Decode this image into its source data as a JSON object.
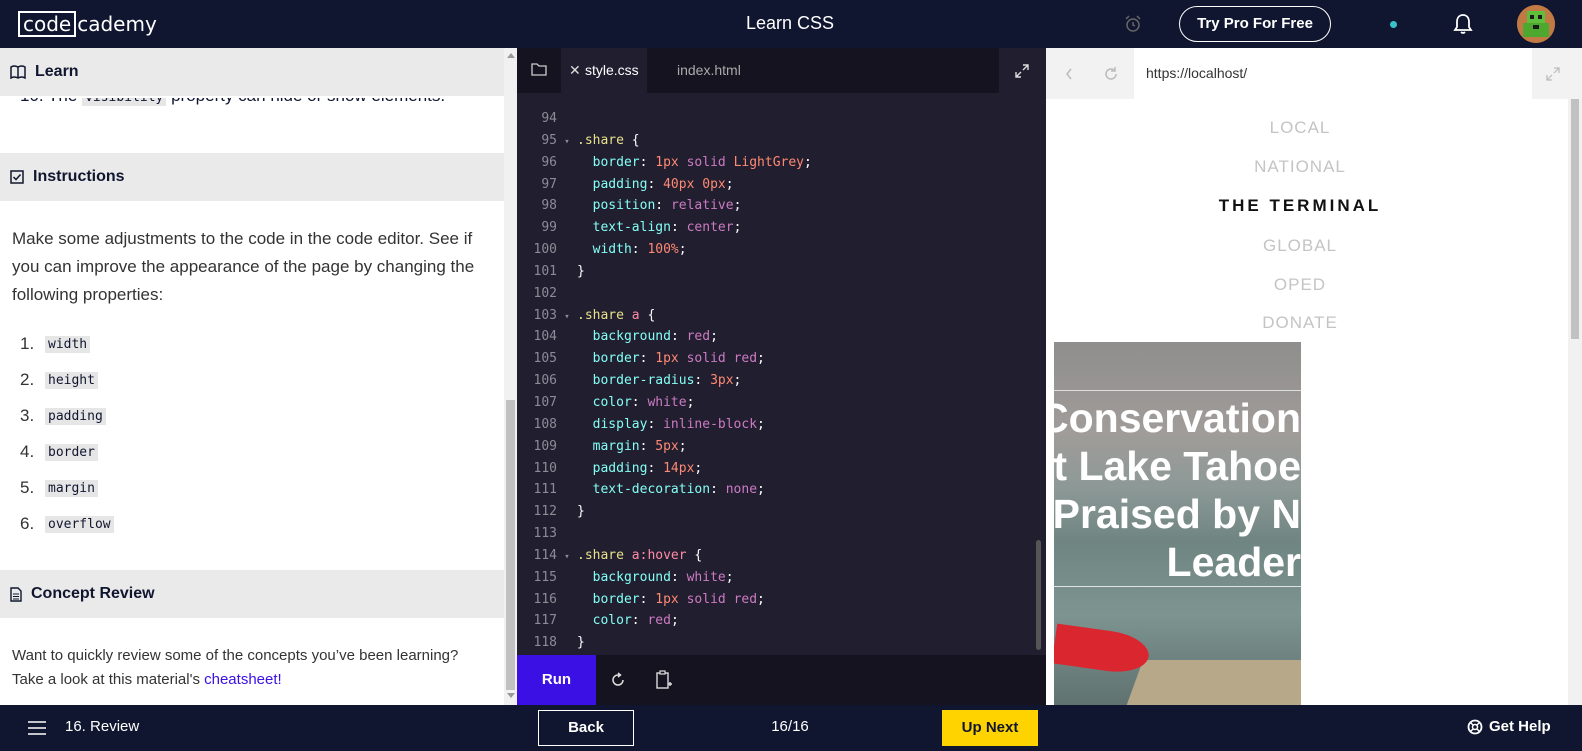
{
  "topbar": {
    "logo_box": "code",
    "logo_rest": "cademy",
    "title": "Learn CSS",
    "pro_button": "Try Pro For Free"
  },
  "left": {
    "learn_label": "Learn",
    "cut_item_number": "10. The",
    "cut_item_code": "visibility",
    "cut_item_rest": "property can hide or show elements.",
    "instructions_label": "Instructions",
    "instructions_text": "Make some adjustments to the code in the code editor. See if you can improve the appearance of the page by changing the following properties:",
    "properties": [
      {
        "n": "1.",
        "code": "width"
      },
      {
        "n": "2.",
        "code": "height"
      },
      {
        "n": "3.",
        "code": "padding"
      },
      {
        "n": "4.",
        "code": "border"
      },
      {
        "n": "5.",
        "code": "margin"
      },
      {
        "n": "6.",
        "code": "overflow"
      }
    ],
    "concept_label": "Concept Review",
    "concept_text": "Want to quickly review some of the concepts you’ve been learning? Take a look at this material's",
    "concept_link": "cheatsheet!"
  },
  "editor": {
    "tab_active": "style.css",
    "tab_inactive": "index.html",
    "run_label": "Run",
    "lines": [
      {
        "n": "94",
        "fold": "",
        "tokens": []
      },
      {
        "n": "95",
        "fold": "▾",
        "tokens": [
          [
            "c-sel",
            ".share "
          ],
          [
            "c-plain",
            "{"
          ]
        ]
      },
      {
        "n": "96",
        "fold": "",
        "tokens": [
          [
            "c-plain",
            "  "
          ],
          [
            "c-prop",
            "border"
          ],
          [
            "c-plain",
            ": "
          ],
          [
            "c-num",
            "1px"
          ],
          [
            "c-plain",
            " "
          ],
          [
            "c-str",
            "solid"
          ],
          [
            "c-plain",
            " "
          ],
          [
            "c-num",
            "LightGrey"
          ],
          [
            "c-plain",
            ";"
          ]
        ]
      },
      {
        "n": "97",
        "fold": "",
        "tokens": [
          [
            "c-plain",
            "  "
          ],
          [
            "c-prop",
            "padding"
          ],
          [
            "c-plain",
            ": "
          ],
          [
            "c-num",
            "40px 0px"
          ],
          [
            "c-plain",
            ";"
          ]
        ]
      },
      {
        "n": "98",
        "fold": "",
        "tokens": [
          [
            "c-plain",
            "  "
          ],
          [
            "c-prop",
            "position"
          ],
          [
            "c-plain",
            ": "
          ],
          [
            "c-str",
            "relative"
          ],
          [
            "c-plain",
            ";"
          ]
        ]
      },
      {
        "n": "99",
        "fold": "",
        "tokens": [
          [
            "c-plain",
            "  "
          ],
          [
            "c-prop",
            "text-align"
          ],
          [
            "c-plain",
            ": "
          ],
          [
            "c-str",
            "center"
          ],
          [
            "c-plain",
            ";"
          ]
        ]
      },
      {
        "n": "100",
        "fold": "",
        "tokens": [
          [
            "c-plain",
            "  "
          ],
          [
            "c-prop",
            "width"
          ],
          [
            "c-plain",
            ": "
          ],
          [
            "c-num",
            "100%"
          ],
          [
            "c-plain",
            ";"
          ]
        ]
      },
      {
        "n": "101",
        "fold": "",
        "tokens": [
          [
            "c-plain",
            "}"
          ]
        ]
      },
      {
        "n": "102",
        "fold": "",
        "tokens": []
      },
      {
        "n": "103",
        "fold": "▾",
        "tokens": [
          [
            "c-sel",
            ".share "
          ],
          [
            "c-hover",
            "a"
          ],
          [
            "c-plain",
            " {"
          ]
        ]
      },
      {
        "n": "104",
        "fold": "",
        "tokens": [
          [
            "c-plain",
            "  "
          ],
          [
            "c-prop",
            "background"
          ],
          [
            "c-plain",
            ": "
          ],
          [
            "c-str",
            "red"
          ],
          [
            "c-plain",
            ";"
          ]
        ]
      },
      {
        "n": "105",
        "fold": "",
        "tokens": [
          [
            "c-plain",
            "  "
          ],
          [
            "c-prop",
            "border"
          ],
          [
            "c-plain",
            ": "
          ],
          [
            "c-num",
            "1px"
          ],
          [
            "c-plain",
            " "
          ],
          [
            "c-str",
            "solid"
          ],
          [
            "c-plain",
            " "
          ],
          [
            "c-str",
            "red"
          ],
          [
            "c-plain",
            ";"
          ]
        ]
      },
      {
        "n": "106",
        "fold": "",
        "tokens": [
          [
            "c-plain",
            "  "
          ],
          [
            "c-prop",
            "border-radius"
          ],
          [
            "c-plain",
            ": "
          ],
          [
            "c-num",
            "3px"
          ],
          [
            "c-plain",
            ";"
          ]
        ]
      },
      {
        "n": "107",
        "fold": "",
        "tokens": [
          [
            "c-plain",
            "  "
          ],
          [
            "c-prop",
            "color"
          ],
          [
            "c-plain",
            ": "
          ],
          [
            "c-str",
            "white"
          ],
          [
            "c-plain",
            ";"
          ]
        ]
      },
      {
        "n": "108",
        "fold": "",
        "tokens": [
          [
            "c-plain",
            "  "
          ],
          [
            "c-prop",
            "display"
          ],
          [
            "c-plain",
            ": "
          ],
          [
            "c-str",
            "inline-block"
          ],
          [
            "c-plain",
            ";"
          ]
        ]
      },
      {
        "n": "109",
        "fold": "",
        "tokens": [
          [
            "c-plain",
            "  "
          ],
          [
            "c-prop",
            "margin"
          ],
          [
            "c-plain",
            ": "
          ],
          [
            "c-num",
            "5px"
          ],
          [
            "c-plain",
            ";"
          ]
        ]
      },
      {
        "n": "110",
        "fold": "",
        "tokens": [
          [
            "c-plain",
            "  "
          ],
          [
            "c-prop",
            "padding"
          ],
          [
            "c-plain",
            ": "
          ],
          [
            "c-num",
            "14px"
          ],
          [
            "c-plain",
            ";"
          ]
        ]
      },
      {
        "n": "111",
        "fold": "",
        "tokens": [
          [
            "c-plain",
            "  "
          ],
          [
            "c-prop",
            "text-decoration"
          ],
          [
            "c-plain",
            ": "
          ],
          [
            "c-str",
            "none"
          ],
          [
            "c-plain",
            ";"
          ]
        ]
      },
      {
        "n": "112",
        "fold": "",
        "tokens": [
          [
            "c-plain",
            "}"
          ]
        ]
      },
      {
        "n": "113",
        "fold": "",
        "tokens": []
      },
      {
        "n": "114",
        "fold": "▾",
        "tokens": [
          [
            "c-sel",
            ".share "
          ],
          [
            "c-hover",
            "a:hover"
          ],
          [
            "c-plain",
            " {"
          ]
        ]
      },
      {
        "n": "115",
        "fold": "",
        "tokens": [
          [
            "c-plain",
            "  "
          ],
          [
            "c-prop",
            "background"
          ],
          [
            "c-plain",
            ": "
          ],
          [
            "c-str",
            "white"
          ],
          [
            "c-plain",
            ";"
          ]
        ]
      },
      {
        "n": "116",
        "fold": "",
        "tokens": [
          [
            "c-plain",
            "  "
          ],
          [
            "c-prop",
            "border"
          ],
          [
            "c-plain",
            ": "
          ],
          [
            "c-num",
            "1px"
          ],
          [
            "c-plain",
            " "
          ],
          [
            "c-str",
            "solid"
          ],
          [
            "c-plain",
            " "
          ],
          [
            "c-str",
            "red"
          ],
          [
            "c-plain",
            ";"
          ]
        ]
      },
      {
        "n": "117",
        "fold": "",
        "tokens": [
          [
            "c-plain",
            "  "
          ],
          [
            "c-prop",
            "color"
          ],
          [
            "c-plain",
            ": "
          ],
          [
            "c-str",
            "red"
          ],
          [
            "c-plain",
            ";"
          ]
        ]
      },
      {
        "n": "118",
        "fold": "",
        "tokens": [
          [
            "c-plain",
            "}"
          ]
        ]
      }
    ]
  },
  "browser": {
    "url": "https://localhost/",
    "nav": [
      {
        "label": "LOCAL",
        "active": false
      },
      {
        "label": "NATIONAL",
        "active": false
      },
      {
        "label": "THE TERMINAL",
        "active": true
      },
      {
        "label": "GLOBAL",
        "active": false
      },
      {
        "label": "OPED",
        "active": false
      },
      {
        "label": "DONATE",
        "active": false
      }
    ],
    "hero_lines": [
      "Conservation",
      "at Lake Tahoe",
      "Praised by N",
      "Leader"
    ]
  },
  "bottombar": {
    "lesson": "16. Review",
    "back": "Back",
    "progress": "16/16",
    "next": "Up Next",
    "help": "Get Help"
  },
  "colors": {
    "navy": "#10162f",
    "run_purple": "#3a10e5",
    "next_yellow": "#ffd300",
    "editor_bg": "#211e2f"
  },
  "icons": [
    "book-icon",
    "checkbox-icon",
    "document-icon",
    "alarm-icon",
    "bell-icon",
    "folder-icon",
    "close-icon",
    "expand-icon",
    "refresh-icon",
    "copy-icon",
    "back-arrow-icon",
    "reload-icon",
    "menu-icon",
    "help-icon"
  ]
}
